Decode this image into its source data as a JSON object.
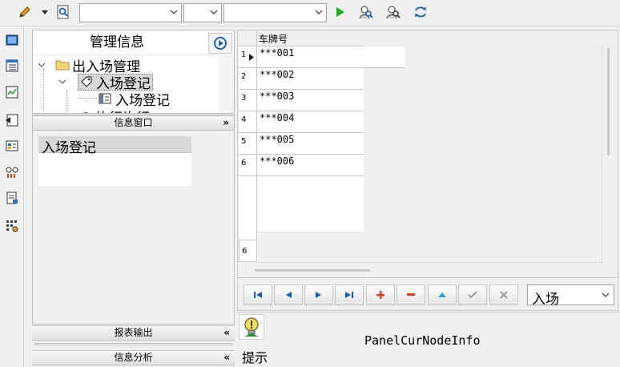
{
  "toolbar": {
    "combos": [
      {
        "value": "",
        "placeholder": ""
      },
      {
        "value": "",
        "placeholder": ""
      },
      {
        "value": "",
        "placeholder": ""
      }
    ]
  },
  "tree_panel": {
    "title": "管理信息",
    "nodes": [
      {
        "label": "出入场管理",
        "icon": "folder-icon",
        "expanded": true
      },
      {
        "label": "入场登记",
        "icon": "tag-icon",
        "expanded": true,
        "selected": true
      },
      {
        "label": "入场登记",
        "icon": "form-icon"
      },
      {
        "label": "执行许行",
        "icon": "gear-icon",
        "partially_visible": true
      }
    ]
  },
  "info_window": {
    "header": "信息窗口",
    "item": "入场登记"
  },
  "report_output": {
    "header": "报表输出"
  },
  "info_analysis": {
    "header": "信息分析"
  },
  "grid": {
    "column_header": "车牌号",
    "rows": [
      {
        "num": "1",
        "plate": "***001",
        "current": true
      },
      {
        "num": "2",
        "plate": "***002"
      },
      {
        "num": "3",
        "plate": "***003"
      },
      {
        "num": "4",
        "plate": "***004"
      },
      {
        "num": "5",
        "plate": "***005"
      },
      {
        "num": "6",
        "plate": "***006"
      }
    ],
    "footer_count": "6"
  },
  "navigator": {
    "buttons": [
      "first",
      "prior",
      "next",
      "last",
      "insert",
      "delete",
      "edit",
      "post",
      "cancel"
    ],
    "mode_select": "入场"
  },
  "status": {
    "hint_label": "提示",
    "node_info": "PanelCurNodeInfo"
  },
  "colors": {
    "accent_blue": "#1a5fb4",
    "nav_red": "#e03c1e",
    "play_green": "#16b01e",
    "selected_bg": "#d8d8d8"
  }
}
